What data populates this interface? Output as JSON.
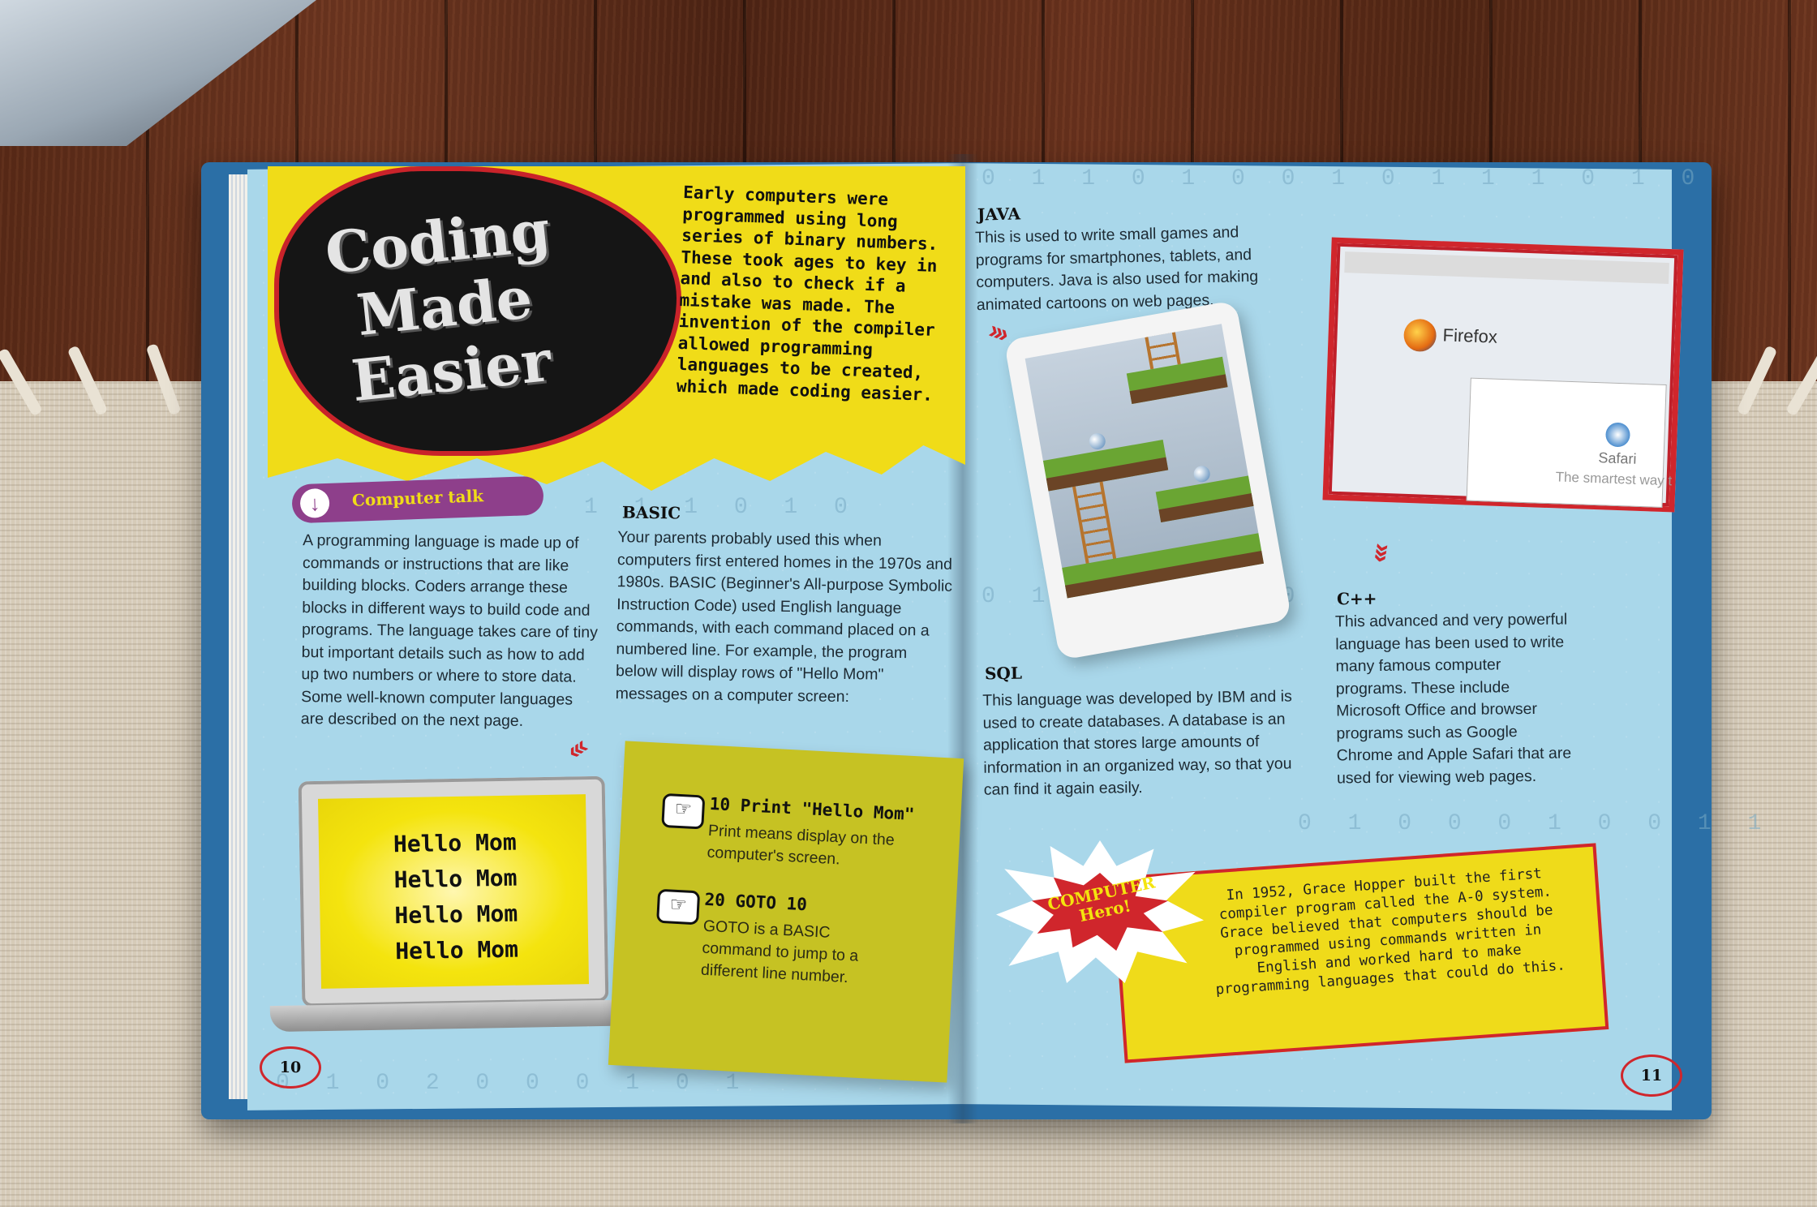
{
  "left_page": {
    "title_lines": [
      "Coding",
      "Made",
      "Easier"
    ],
    "intro_text": "Early computers were programmed using long series of binary numbers. These took ages to key in and also to check if a mistake was made. The invention of the compiler allowed programming languages to be created, which made coding easier.",
    "computer_talk": {
      "label": "Computer talk",
      "text": "A programming language is made up of commands or instructions that are like building blocks. Coders arrange these blocks in different ways to build code and programs. The language takes care of tiny but important details such as how to add up two numbers or where to store data. Some well-known computer languages are described on the next page."
    },
    "basic": {
      "heading": "BASIC",
      "text": "Your parents probably used this when computers first entered homes in the 1970s and 1980s. BASIC (Beginner's All-purpose Symbolic Instruction Code) used English language commands, with each command placed on a numbered line. For example, the program below will display rows of \"Hello Mom\" messages on a computer screen:"
    },
    "laptop_lines": [
      "Hello Mom",
      "Hello Mom",
      "Hello Mom",
      "Hello Mom"
    ],
    "code": [
      {
        "line": "10 Print \"Hello Mom\"",
        "desc": "Print means display on the computer's screen."
      },
      {
        "line": "20 GOTO 10",
        "desc": "GOTO is a BASIC command to jump to a different line number."
      }
    ],
    "page_number": "10"
  },
  "right_page": {
    "java": {
      "heading": "JAVA",
      "text": "This is used to write small games and programs for smartphones, tablets, and computers. Java is also used for making animated cartoons on web pages."
    },
    "sql": {
      "heading": "SQL",
      "text": "This language was developed by IBM and is used to create databases. A database is an application that stores large amounts of information in an organized way, so that you can find it again easily."
    },
    "cpp": {
      "heading": "C++",
      "text": "This advanced and very powerful language has been used to write many famous computer programs. These include Microsoft Office and browser programs such as Google Chrome and Apple Safari that are used for viewing web pages."
    },
    "browser_screenshot": {
      "firefox_label": "Firefox",
      "safari_label": "Safari",
      "safari_slogan": "The smartest way t"
    },
    "hero": {
      "badge": "COMPUTER Hero!",
      "text": "In 1952, Grace Hopper built the first compiler program called the A-0 system. Grace believed that computers should be programmed using commands written in English and worked hard to make programming languages that could do this."
    },
    "page_number": "11"
  },
  "colors": {
    "page_blue": "#a9d7ea",
    "banner_yellow": "#f0dc18",
    "accent_red": "#d0262c",
    "pill_purple": "#8e3f8b",
    "sticky_green": "#c6c223"
  }
}
